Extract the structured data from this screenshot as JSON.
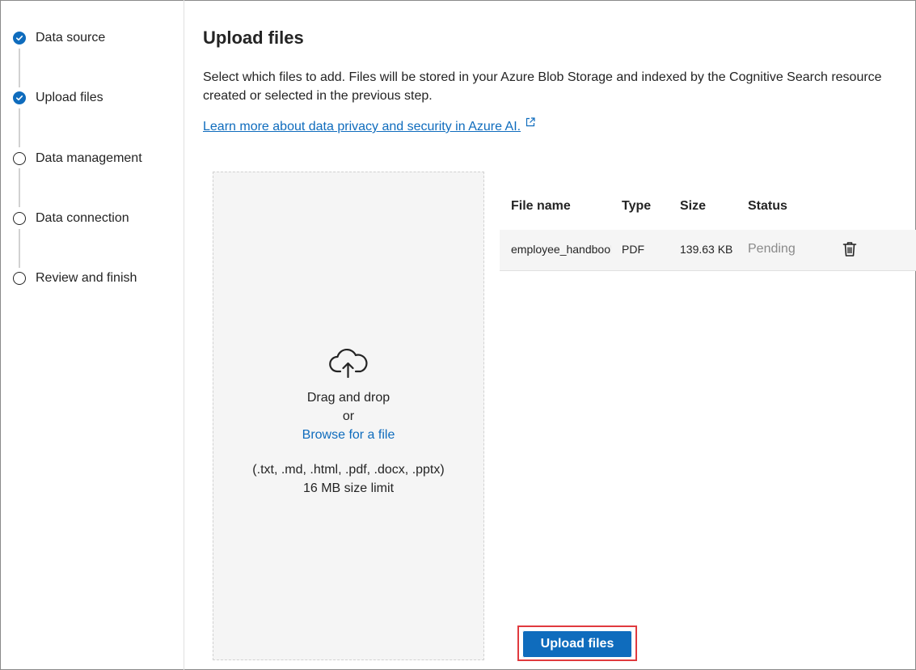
{
  "sidebar": {
    "steps": [
      {
        "label": "Data source",
        "state": "completed"
      },
      {
        "label": "Upload files",
        "state": "completed"
      },
      {
        "label": "Data management",
        "state": "pending"
      },
      {
        "label": "Data connection",
        "state": "pending"
      },
      {
        "label": "Review and finish",
        "state": "pending"
      }
    ]
  },
  "main": {
    "title": "Upload files",
    "description": "Select which files to add. Files will be stored in your Azure Blob Storage and indexed by the Cognitive Search resource created or selected in the previous step.",
    "learn_more_link": "Learn more about data privacy and security in Azure AI."
  },
  "dropzone": {
    "icon": "cloud-upload-icon",
    "drag_text": "Drag and drop",
    "or_text": "or",
    "browse_link": "Browse for a file",
    "file_types": "(.txt, .md, .html, .pdf, .docx, .pptx)",
    "size_limit": "16 MB size limit"
  },
  "file_table": {
    "columns": [
      "File name",
      "Type",
      "Size",
      "Status"
    ],
    "rows": [
      {
        "file_name": "employee_handbool",
        "type": "PDF",
        "size": "139.63 KB",
        "status": "Pending"
      }
    ]
  },
  "upload_button": {
    "label": "Upload files"
  },
  "colors": {
    "accent": "#0f6cbd",
    "highlight_outline": "#e03a3e",
    "dropzone_bg": "#f5f5f5",
    "muted_text": "#8a8a8a"
  }
}
